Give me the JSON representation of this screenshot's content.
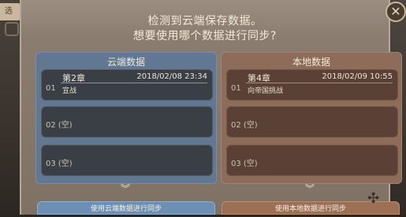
{
  "background": {
    "back_tab_label": "选"
  },
  "dialog": {
    "title_line1": "检测到云端保存数据。",
    "title_line2": "想要使用哪个数据进行同步?",
    "close_label": "✕"
  },
  "cloud": {
    "header": "云端数据",
    "slot1": {
      "num": "01",
      "chapter": "第2章",
      "date": "2018/02/08 23:34",
      "desc": "宣战"
    },
    "slot2": {
      "label": "02 (空)"
    },
    "slot3": {
      "label": "03 (空)"
    },
    "button": "使用云端数据进行同步"
  },
  "local": {
    "header": "本地数据",
    "slot1": {
      "num": "01",
      "chapter": "第4章",
      "date": "2018/02/09 10:55",
      "desc": "向帝国挑战"
    },
    "slot2": {
      "label": "02 (空)"
    },
    "slot3": {
      "label": "03 (空)"
    },
    "button": "使用本地数据进行同步"
  },
  "icons": {
    "chevron": "︾",
    "ornament": "✣"
  }
}
